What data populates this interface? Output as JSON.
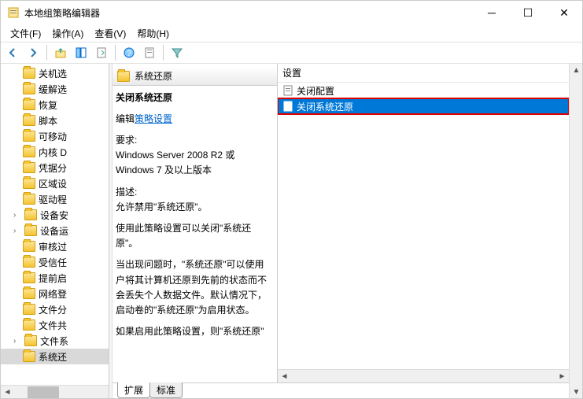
{
  "window": {
    "title": "本地组策略编辑器"
  },
  "menu": {
    "file": "文件(F)",
    "action": "操作(A)",
    "view": "查看(V)",
    "help": "帮助(H)"
  },
  "tree": {
    "items": [
      {
        "label": "关机选",
        "arrow": false
      },
      {
        "label": "缓解选",
        "arrow": false
      },
      {
        "label": "恢复",
        "arrow": false
      },
      {
        "label": "脚本",
        "arrow": false
      },
      {
        "label": "可移动",
        "arrow": false
      },
      {
        "label": "内核 D",
        "arrow": false
      },
      {
        "label": "凭据分",
        "arrow": false
      },
      {
        "label": "区域设",
        "arrow": false
      },
      {
        "label": "驱动程",
        "arrow": false
      },
      {
        "label": "设备安",
        "arrow": true
      },
      {
        "label": "设备运",
        "arrow": true
      },
      {
        "label": "审核过",
        "arrow": false
      },
      {
        "label": "受信任",
        "arrow": false
      },
      {
        "label": "提前启",
        "arrow": false
      },
      {
        "label": "网络登",
        "arrow": false
      },
      {
        "label": "文件分",
        "arrow": false
      },
      {
        "label": "文件共",
        "arrow": false
      },
      {
        "label": "文件系",
        "arrow": true
      },
      {
        "label": "系统还",
        "arrow": false,
        "selected": true
      }
    ]
  },
  "header": {
    "node_title": "系统还原"
  },
  "description": {
    "title": "关闭系统还原",
    "edit_prefix": "编辑",
    "edit_link": "策略设置",
    "req_label": "要求:",
    "req_text": "Windows Server 2008 R2 或 Windows 7 及以上版本",
    "desc_label": "描述:",
    "desc_1": "允许禁用\"系统还原\"。",
    "desc_2": "使用此策略设置可以关闭\"系统还原\"。",
    "desc_3": "当出现问题时，\"系统还原\"可以使用户将其计算机还原到先前的状态而不会丢失个人数据文件。默认情况下，启动卷的\"系统还原\"为启用状态。",
    "desc_4": "如果启用此策略设置，则\"系统还原\""
  },
  "settings": {
    "header": "设置",
    "items": [
      {
        "label": "关闭配置",
        "selected": false
      },
      {
        "label": "关闭系统还原",
        "selected": true
      }
    ]
  },
  "tabs": {
    "extended": "扩展",
    "standard": "标准"
  }
}
